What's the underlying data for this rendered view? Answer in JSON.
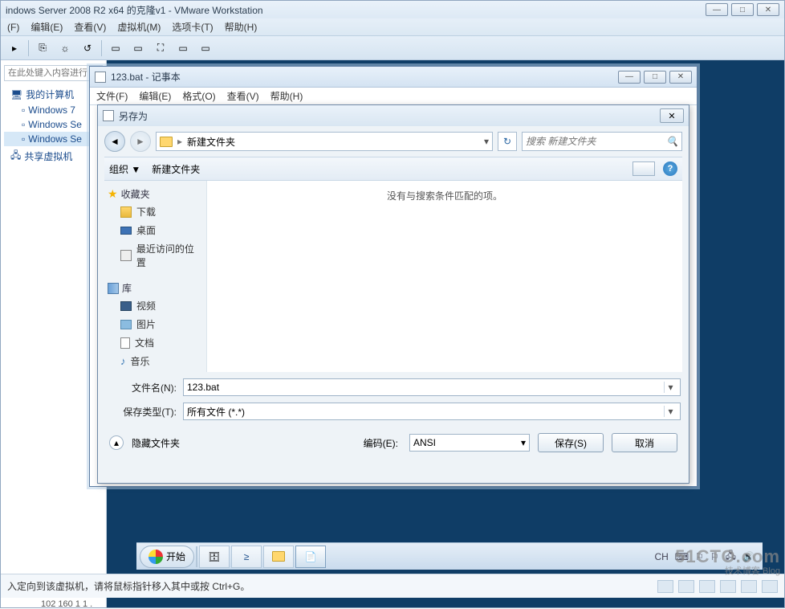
{
  "vmware": {
    "title": "indows Server 2008 R2 x64 的克隆v1 - VMware Workstation",
    "menu": [
      "(F)",
      "编辑(E)",
      "查看(V)",
      "虚拟机(M)",
      "选项卡(T)",
      "帮助(H)"
    ],
    "sidebar": {
      "search_placeholder": "在此处键入内容进行",
      "root": "我的计算机",
      "items": [
        "Windows 7",
        "Windows Se",
        "Windows Se"
      ],
      "shared": "共享虚拟机"
    },
    "statusbar": "入定向到该虚拟机，请将鼠标指针移入其中或按 Ctrl+G。",
    "ip_fragment": "102 160 1 1 ."
  },
  "notepad": {
    "title": "123.bat - 记事本",
    "menu": [
      "文件(F)",
      "编辑(E)",
      "格式(O)",
      "查看(V)",
      "帮助(H)"
    ]
  },
  "saveas": {
    "title": "另存为",
    "breadcrumb": "新建文件夹",
    "search_placeholder": "搜索 新建文件夹",
    "toolbar": {
      "organize": "组织 ▼",
      "newfolder": "新建文件夹"
    },
    "tree": {
      "favorites": "收藏夹",
      "fav_items": [
        "下载",
        "桌面",
        "最近访问的位置"
      ],
      "libraries": "库",
      "lib_items": [
        "视频",
        "图片",
        "文档",
        "音乐"
      ]
    },
    "empty_msg": "没有与搜索条件匹配的项。",
    "filename_label": "文件名(N):",
    "filename_value": "123.bat",
    "filetype_label": "保存类型(T):",
    "filetype_value": "所有文件  (*.*)",
    "hide_folders": "隐藏文件夹",
    "encoding_label": "编码(E):",
    "encoding_value": "ANSI",
    "save_btn": "保存(S)",
    "cancel_btn": "取消"
  },
  "taskbar": {
    "start": "开始",
    "lang": "CH"
  },
  "watermark": {
    "big": "51CTO.com",
    "small": "技术博客   Blog"
  }
}
